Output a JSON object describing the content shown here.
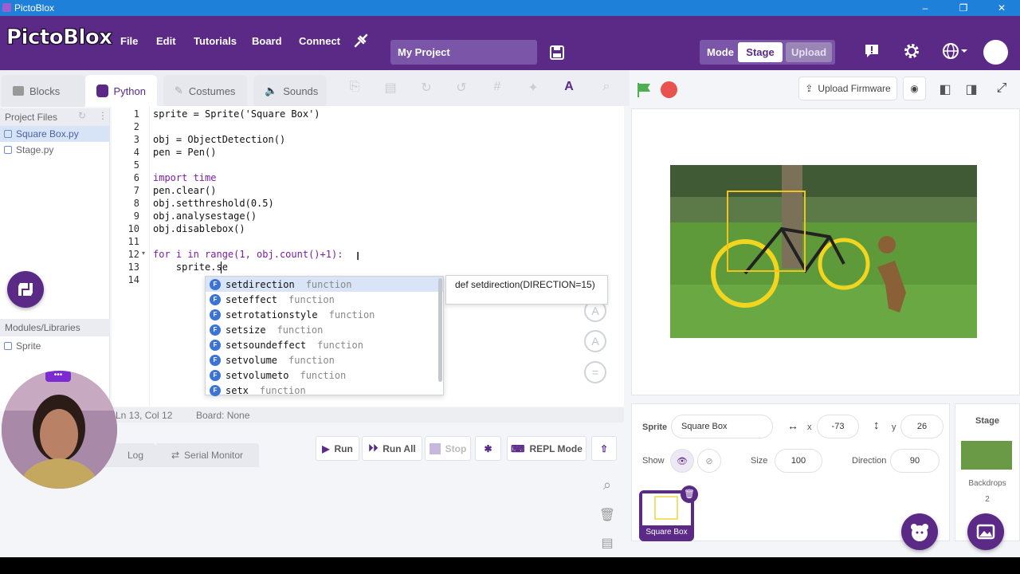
{
  "window": {
    "title": "PictoBlox",
    "controls": [
      "–",
      "❐",
      "✕"
    ]
  },
  "menubar": {
    "logo": "PictoBlox",
    "items": [
      "File",
      "Edit",
      "Tutorials",
      "Board",
      "Connect"
    ],
    "project_name": "My Project",
    "mode_label": "Mode",
    "mode_stage": "Stage",
    "mode_upload": "Upload"
  },
  "tabs": [
    "Blocks",
    "Python",
    "Costumes",
    "Sounds"
  ],
  "toolbar": {
    "upload_firmware": "Upload Firmware"
  },
  "files": {
    "header": "Project Files",
    "items": [
      "Square Box.py",
      "Stage.py"
    ],
    "modules_header": "Modules/Libraries",
    "modules": [
      "Sprite"
    ]
  },
  "editor": {
    "line_numbers": [
      "1",
      "2",
      "3",
      "4",
      "5",
      "6",
      "7",
      "8",
      "9",
      "10",
      "11",
      "12",
      "13",
      "14"
    ],
    "lines": [
      "sprite = Sprite('Square Box')",
      "",
      "obj = ObjectDetection()",
      "pen = Pen()",
      "",
      "import time",
      "pen.clear()",
      "obj.setthreshold(0.5)",
      "obj.analysestage()",
      "obj.disablebox()",
      "",
      "for i in range(1, obj.count()+1):",
      "    sprite.se",
      ""
    ]
  },
  "autocomplete": {
    "items": [
      {
        "name": "setdirection",
        "type": "function"
      },
      {
        "name": "seteffect",
        "type": "function"
      },
      {
        "name": "setrotationstyle",
        "type": "function"
      },
      {
        "name": "setsize",
        "type": "function"
      },
      {
        "name": "setsoundeffect",
        "type": "function"
      },
      {
        "name": "setvolume",
        "type": "function"
      },
      {
        "name": "setvolumeto",
        "type": "function"
      },
      {
        "name": "setx",
        "type": "function"
      }
    ],
    "signature": "def setdirection(DIRECTION=15)",
    "badge": "F"
  },
  "status": {
    "position": "Ln 13, Col 12",
    "board": "Board: None"
  },
  "run_controls": {
    "run": "Run",
    "run_all": "Run All",
    "stop": "Stop",
    "repl": "REPL Mode"
  },
  "bottom_tabs": {
    "log": "Log",
    "serial": "Serial Monitor"
  },
  "sprite_info": {
    "sprite_label": "Sprite",
    "sprite_name": "Square Box",
    "x_label": "x",
    "x_value": "-73",
    "y_label": "y",
    "y_value": "26",
    "show_label": "Show",
    "size_label": "Size",
    "size_value": "100",
    "direction_label": "Direction",
    "direction_value": "90",
    "thumb_name": "Square Box"
  },
  "stage_panel": {
    "title": "Stage",
    "backdrops_label": "Backdrops",
    "backdrops_count": "2"
  },
  "colors": {
    "brand": "#5a2a86",
    "titlebar": "#1e80d8",
    "accent_yellow": "#f2d51f"
  }
}
